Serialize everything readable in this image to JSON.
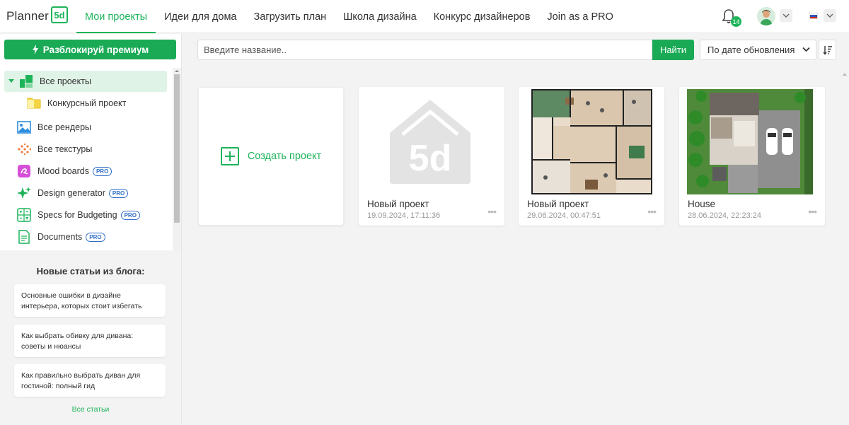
{
  "app": {
    "logo_text": "Planner",
    "logo_badge": "5d"
  },
  "nav": {
    "items": [
      {
        "label": "Мои проекты",
        "active": true
      },
      {
        "label": "Идеи для дома"
      },
      {
        "label": "Загрузить план"
      },
      {
        "label": "Школа дизайна"
      },
      {
        "label": "Конкурс дизайнеров"
      },
      {
        "label": "Join as a PRO"
      }
    ],
    "notifications_count": "14"
  },
  "sidebar": {
    "premium_button": "Разблокируй премиум",
    "menu": [
      {
        "label": "Все проекты",
        "icon": "all-projects-icon",
        "selected": true
      },
      {
        "label": "Конкурсный проект",
        "icon": "folder-icon",
        "sub": true
      },
      {
        "label": "Все рендеры",
        "icon": "renders-icon"
      },
      {
        "label": "Все текстуры",
        "icon": "textures-icon"
      },
      {
        "label": "Mood boards",
        "icon": "mood-boards-icon",
        "pro": "PRO"
      },
      {
        "label": "Design generator",
        "icon": "design-generator-icon",
        "pro": "PRO"
      },
      {
        "label": "Specs for Budgeting",
        "icon": "specs-icon",
        "pro": "PRO"
      },
      {
        "label": "Documents",
        "icon": "documents-icon",
        "pro": "PRO"
      }
    ],
    "blog": {
      "title": "Новые статьи из блога:",
      "articles": [
        "Основные ошибки в дизайне интерьера, которых стоит избегать",
        "Как выбрать обивку для дивана: советы и нюансы",
        "Как правильно выбрать диван для гостиной: полный гид"
      ],
      "all_link": "Все статьи"
    }
  },
  "toolbar": {
    "search_placeholder": "Введите название..",
    "search_button": "Найти",
    "sort_selected": "По дате обновления"
  },
  "projects": {
    "create_label": "Создать проект",
    "items": [
      {
        "name": "Новый проект",
        "date": "19.09.2024, 17:11:36",
        "thumb": "placeholder"
      },
      {
        "name": "Новый проект",
        "date": "29.06.2024, 00:47:51",
        "thumb": "floorplan"
      },
      {
        "name": "House",
        "date": "28.06.2024, 22:23:24",
        "thumb": "house"
      }
    ]
  },
  "colors": {
    "accent": "#1db45a",
    "premium": "#1aaa56",
    "pro_badge": "#2f6ec8"
  }
}
